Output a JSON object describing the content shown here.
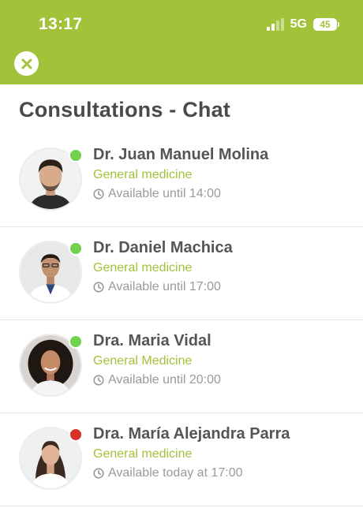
{
  "status_bar": {
    "time": "13:17",
    "network": "5G",
    "battery": "45"
  },
  "header": {
    "close_icon": "close-icon"
  },
  "page": {
    "title": "Consultations - Chat"
  },
  "colors": {
    "brand": "#a2c23a",
    "online": "#6ed24a",
    "offline": "#d9302a"
  },
  "doctors": [
    {
      "name": "Dr. Juan Manuel Molina",
      "specialty": "General medicine",
      "availability": "Available until 14:00",
      "status": "online"
    },
    {
      "name": "Dr. Daniel Machica",
      "specialty": "General medicine",
      "availability": "Available until 17:00",
      "status": "online"
    },
    {
      "name": "Dra. Maria Vidal",
      "specialty": "General Medicine",
      "availability": "Available until 20:00",
      "status": "online"
    },
    {
      "name": "Dra. María Alejandra Parra",
      "specialty": "General medicine",
      "availability": "Available today at 17:00",
      "status": "offline"
    }
  ]
}
